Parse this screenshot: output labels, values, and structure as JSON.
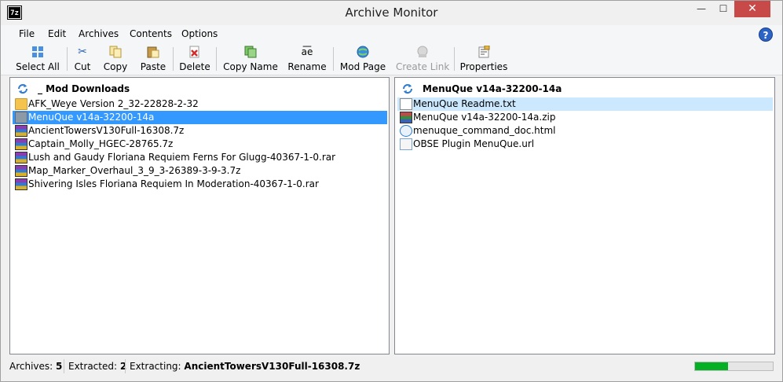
{
  "window": {
    "title": "Archive Monitor",
    "app_icon_text": "7z",
    "min_glyph": "—",
    "max_glyph": "☐",
    "close_glyph": "✕"
  },
  "menu": {
    "items": [
      "File",
      "Edit",
      "Archives",
      "Contents",
      "Options"
    ],
    "help_glyph": "?"
  },
  "toolbar": {
    "select_all": "Select All",
    "cut": "Cut",
    "copy": "Copy",
    "paste": "Paste",
    "delete": "Delete",
    "copy_name": "Copy Name",
    "rename": "Rename",
    "mod_page": "Mod Page",
    "create_link": "Create Link",
    "properties": "Properties",
    "rename_glyph": "a͞e"
  },
  "left_pane": {
    "title": "_ Mod Downloads",
    "items": [
      {
        "name": "AFK_Weye Version 2_32-22828-2-32",
        "type": "folder"
      },
      {
        "name": "MenuQue v14a-32200-14a",
        "type": "folder",
        "selected": true
      },
      {
        "name": "AncientTowersV130Full-16308.7z",
        "type": "archive"
      },
      {
        "name": "Captain_Molly_HGEC-28765.7z",
        "type": "archive"
      },
      {
        "name": "Lush and Gaudy Floriana Requiem Ferns For Glugg-40367-1-0.rar",
        "type": "archive"
      },
      {
        "name": "Map_Marker_Overhaul_3_9_3-26389-3-9-3.7z",
        "type": "archive"
      },
      {
        "name": "Shivering Isles Floriana Requiem In Moderation-40367-1-0.rar",
        "type": "archive"
      }
    ]
  },
  "right_pane": {
    "title": "MenuQue v14a-32200-14a",
    "items": [
      {
        "name": "MenuQue Readme.txt",
        "type": "text",
        "highlighted": true
      },
      {
        "name": "MenuQue v14a-32200-14a.zip",
        "type": "zip"
      },
      {
        "name": "menuque_command_doc.html",
        "type": "html"
      },
      {
        "name": "OBSE Plugin MenuQue.url",
        "type": "url"
      }
    ]
  },
  "status": {
    "archives_label": "Archives:",
    "archives_value": "5",
    "extracted_label": "Extracted:",
    "extracted_value": "2",
    "extracting_label": "Extracting:",
    "extracting_value": "AncientTowersV130Full-16308.7z",
    "progress": 0.42
  },
  "colors": {
    "selection": "#3399ff",
    "highlight": "#cce8ff",
    "progress": "#06b025",
    "close_button": "#c74a48"
  }
}
